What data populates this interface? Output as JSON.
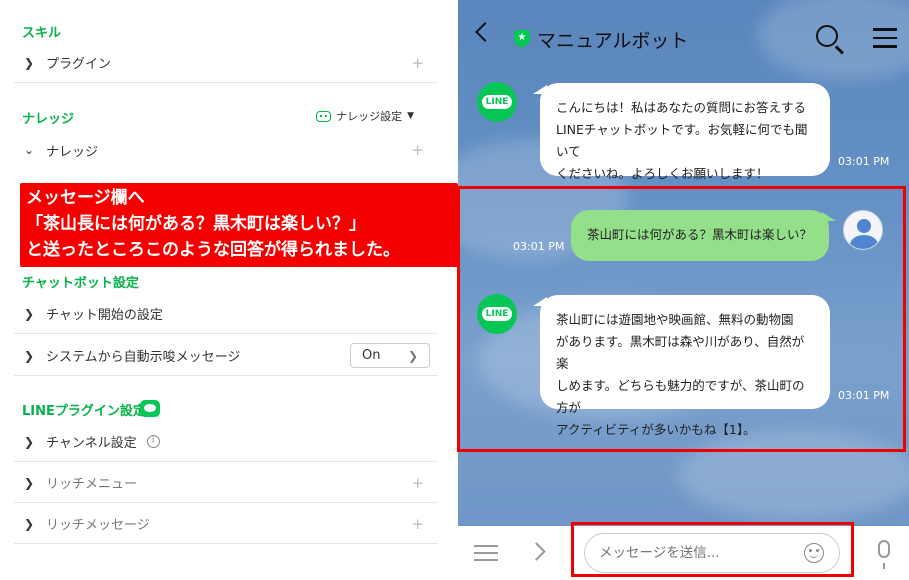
{
  "left_panel": {
    "skills": {
      "title": "スキル",
      "items": [
        {
          "label": "プラグイン"
        }
      ]
    },
    "knowledge": {
      "title": "ナレッジ",
      "settings_label": "ナレッジ設定",
      "items": [
        {
          "label": "ナレッジ"
        }
      ]
    },
    "chatbot_settings": {
      "title": "チャットボット設定",
      "items": [
        {
          "label": "チャット開始の設定"
        },
        {
          "label": "システムから自動示唆メッセージ",
          "toggle_value": "On"
        }
      ]
    },
    "line_plugin_settings": {
      "title": "LINEプラグイン設定",
      "items": [
        {
          "label": "チャンネル設定"
        },
        {
          "label": "リッチメニュー"
        },
        {
          "label": "リッチメッセージ"
        }
      ]
    },
    "plus_icon": "+",
    "info_icon": "i"
  },
  "callout": {
    "lines": [
      "メッセージ欄へ",
      "「茶山長には何がある？黒木町は楽しい？」",
      "と送ったところこのような回答が得られました。"
    ]
  },
  "chat": {
    "bot_name": "マニュアルボット",
    "line_avatar_text": "LINE",
    "messages": [
      {
        "from": "bot",
        "lines": [
          "こんにちは！私はあなたの質問にお答えする",
          "LINEチャットボットです。お気軽に何でも聞いて",
          "くださいね。よろしくお願いします！"
        ],
        "time": "03:01 PM"
      },
      {
        "from": "user",
        "lines": [
          "茶山町には何がある？黒木町は楽しい？"
        ],
        "time": "03:01 PM"
      },
      {
        "from": "bot",
        "lines": [
          "茶山町には遊園地や映画館、無料の動物園",
          "があります。黒木町は森や川があり、自然が楽",
          "しめます。どちらも魅力的ですが、茶山町の方が",
          "アクティビティが多いかもね【1】。"
        ],
        "time": "03:01 PM"
      }
    ],
    "input": {
      "placeholder": "メッセージを送信..."
    }
  },
  "colors": {
    "brand_green": "#06c755",
    "section_green": "#06b24a",
    "annotation_red": "#f40000",
    "chat_bg": "#6591c5",
    "user_bubble": "#94df89"
  }
}
